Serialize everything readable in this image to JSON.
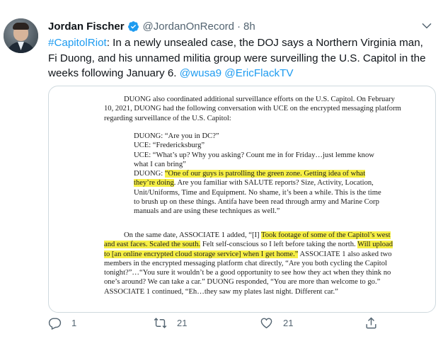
{
  "author": {
    "name": "Jordan Fischer",
    "handle": "@JordanOnRecord",
    "separator": "·",
    "time": "8h"
  },
  "tweet": {
    "hashtag": "#CapitolRiot",
    "text_before": ": In a newly unsealed case, the DOJ says a Northern Virginia man, Fi Duong, and his unnamed militia group were surveilling the U.S. Capitol in the weeks following January 6. ",
    "mention1": "@wusa9",
    "mention2": "@EricFlackTV"
  },
  "document": {
    "p1": [
      "DUONG also coordinated additional surveillance efforts on the U.S. Capitol.  On February",
      "10, 2021, DUONG had the following conversation with UCE on the encrypted messaging platform",
      "regarding surveillance of the U.S. Capitol:"
    ],
    "dialog": {
      "l1": "DUONG: “Are you in DC?”",
      "l2": "UCE: “Fredericksburg”",
      "l3": "UCE: “What’s up? Why you asking? Count me in for Friday…just lemme know",
      "l4": "what I can bring”",
      "l5_pre": "DUONG: ",
      "l5_hl": "“One of our guys is patrolling the green zone. Getting idea of what",
      "l6_hl": "they’re doing",
      "l6_post": ". Are you familiar with SALUTE reports? Size, Activity, Location,",
      "l7": "Unit/Uniforms, Time and Equipment. No shame, it’s been a while. This is the time",
      "l8": "to brush up on these things. Antifa have been read through army and Marine Corp",
      "l9": "manuals and are using these techniques as well.”"
    },
    "p2": {
      "l1_pre": "On the same date, ASSOCIATE 1 added, “[I] ",
      "l1_hl": "Took footage of some of the Capitol’s west",
      "l2_hl": "and east faces.  Scaled the south.",
      "l2_post": "  Felt self-conscious so I left before taking the north.  ",
      "l2_hl2": "Will upload",
      "l3_hl": "to [an online encrypted cloud storage service] when I get home.”",
      "l3_post": "  ASSOCIATE 1 also asked two",
      "l4": "members in the encrypted messaging platform chat directly, “Are you both cycling the Capitol",
      "l5": "tonight?”…“You sure it wouldn’t be a good opportunity to see how they act when they think no",
      "l6": "one’s around?  We can take a car.”  DUONG responded, “You are more than welcome to go.”",
      "l7": "ASSOCIATE 1 continued, “Eh…they saw my plates last night.  Different car.”"
    }
  },
  "actions": {
    "replies": "1",
    "retweets": "21",
    "likes": "21"
  },
  "colors": {
    "link": "#1d9bf0",
    "secondary_text": "#536471",
    "highlight": "#f6ef46",
    "border": "#cfd9de"
  },
  "icons": [
    "verified-badge-icon",
    "chevron-down-icon",
    "reply-icon",
    "retweet-icon",
    "like-icon",
    "share-icon"
  ]
}
